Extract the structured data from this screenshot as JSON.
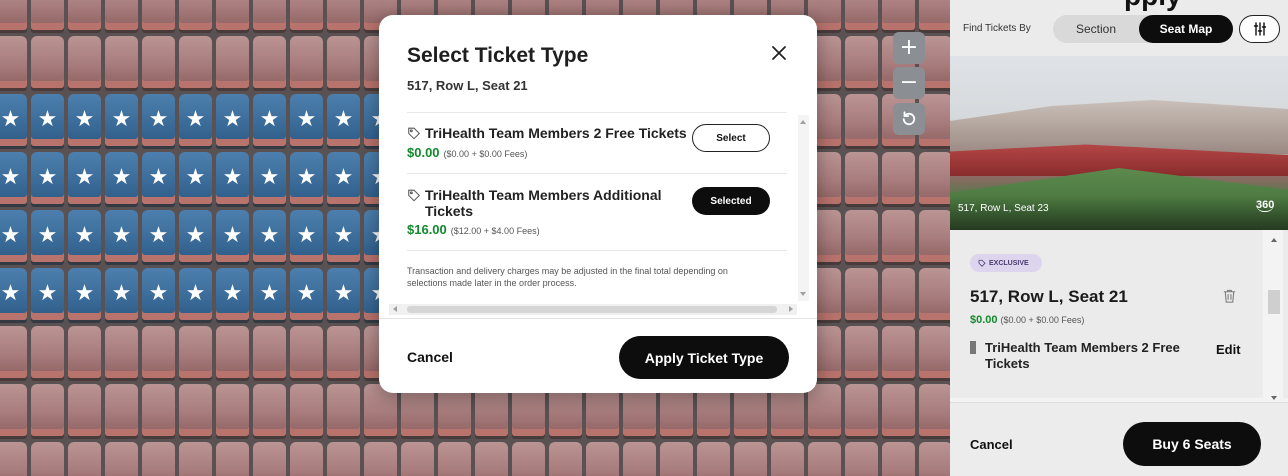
{
  "seat_map": {
    "zoom_in_label": "+",
    "zoom_out_label": "−",
    "reset_icon": "rotate-ccw-icon"
  },
  "modal": {
    "title": "Select Ticket Type",
    "subtitle": "517, Row L, Seat 21",
    "options": [
      {
        "name": "TriHealth Team Members 2 Free Tickets",
        "price": "$0.00",
        "price_detail": "($0.00 + $0.00 Fees)",
        "button_label": "Select",
        "state": "unselected"
      },
      {
        "name": "TriHealth Team Members Additional Tickets",
        "price": "$16.00",
        "price_detail": "($12.00 + $4.00 Fees)",
        "button_label": "Selected",
        "state": "selected"
      }
    ],
    "disclaimer": "Transaction and delivery charges may be adjusted in the final total depending on selections made later in the order process.",
    "cancel_label": "Cancel",
    "apply_label": "Apply Ticket Type"
  },
  "panel": {
    "find_label": "Find Tickets By",
    "toggle_section": "Section",
    "toggle_seat_map": "Seat Map",
    "filter_icon": "filter-sliders-icon",
    "header_partial": "pply",
    "photo_caption": "517, Row L, Seat 23",
    "view_360_label": "360",
    "card": {
      "badge": "EXCLUSIVE",
      "seat": "517, Row L, Seat 21",
      "price": "$0.00",
      "price_detail": "($0.00 + $0.00 Fees)",
      "ticket_type": "TriHealth Team Members 2 Free Tickets",
      "edit_label": "Edit"
    },
    "cancel_label": "Cancel",
    "buy_label": "Buy 6 Seats"
  },
  "colors": {
    "price_green": "#128a2c",
    "button_black": "#0d0d0d",
    "seat_blue": "#3a6b98",
    "seat_red": "#a87c7c",
    "badge_purple": "#ddd4ee"
  }
}
